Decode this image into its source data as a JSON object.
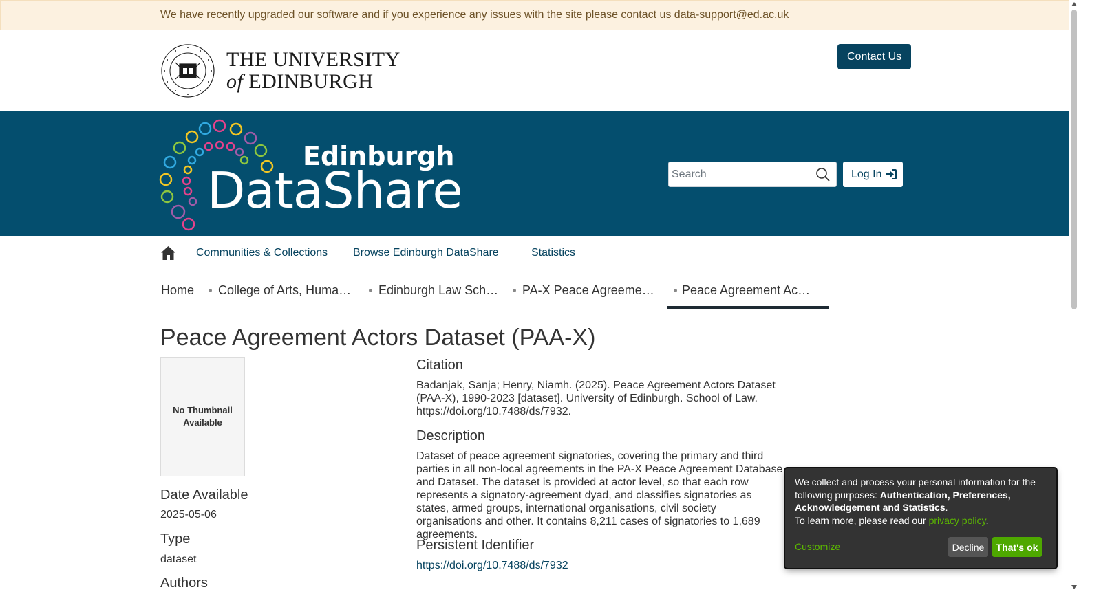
{
  "notice": {
    "text": "We have recently upgraded our software and if you experience any issues with the site please contact us data-support@ed.ac.uk"
  },
  "uoe_header": {
    "line1": "THE UNIVERSITY",
    "line2_of": "of",
    "line2_rest": "EDINBURGH",
    "seal_text": "THE UNIVERSITY OF EDINBURGH",
    "contact_label": "Contact Us"
  },
  "banner": {
    "logo_top": "Edinburgh",
    "logo_bottom": "DataShare",
    "search_placeholder": "Search",
    "login_label": "Log In"
  },
  "nav": {
    "items": [
      {
        "label": "Communities & Collections"
      },
      {
        "label": "Browse Edinburgh DataShare"
      },
      {
        "label": "Statistics"
      }
    ]
  },
  "breadcrumb": {
    "items": [
      {
        "label": "Home"
      },
      {
        "label": "College of Arts, Humanities and Social Sciences"
      },
      {
        "label": "Edinburgh Law School"
      },
      {
        "label": "PA-X Peace Agreements Database"
      },
      {
        "label": "Peace Agreement Actors Dataset (PAA-X)"
      }
    ]
  },
  "item": {
    "title": "Peace Agreement Actors Dataset (PAA-X)",
    "thumbnail_text": "No Thumbnail Available",
    "date_available_label": "Date Available",
    "date_available": "2025-05-06",
    "type_label": "Type",
    "type": "dataset",
    "authors_label": "Authors",
    "citation_label": "Citation",
    "citation": "Badanjak, Sanja; Henry, Niamh. (2025). Peace Agreement Actors Dataset (PAA-X), 1990-2023 [dataset]. University of Edinburgh. School of Law. https://doi.org/10.7488/ds/7932.",
    "description_label": "Description",
    "description": "Dataset of peace agreement signatories, covering the primary and third parties in all non-local agreements in the PA-X Peace Agreement Database and Dataset. The dataset is provided at actor level, so that each row represents a signatory-agreement dyad, and classifies signatories as states, armed groups, international organisations, civil society organisations and other. It contains 8,211 cases of signatories to 1,689 agreements.",
    "pid_label": "Persistent Identifier",
    "pid": "https://doi.org/10.7488/ds/7932"
  },
  "cookie": {
    "text_before": "We collect and process your personal information for the following purposes: ",
    "purposes": "Authentication, Preferences, Acknowledgement and Statistics",
    "text_after": ".",
    "learn_more": "To learn more, please read our ",
    "privacy_link": "privacy policy",
    "period": ".",
    "customize": "Customize",
    "decline": "Decline",
    "accept": "That's ok"
  },
  "colors": {
    "brand_dark": "#044e6e",
    "link": "#06435f",
    "cookie_accent": "#5cb900"
  }
}
